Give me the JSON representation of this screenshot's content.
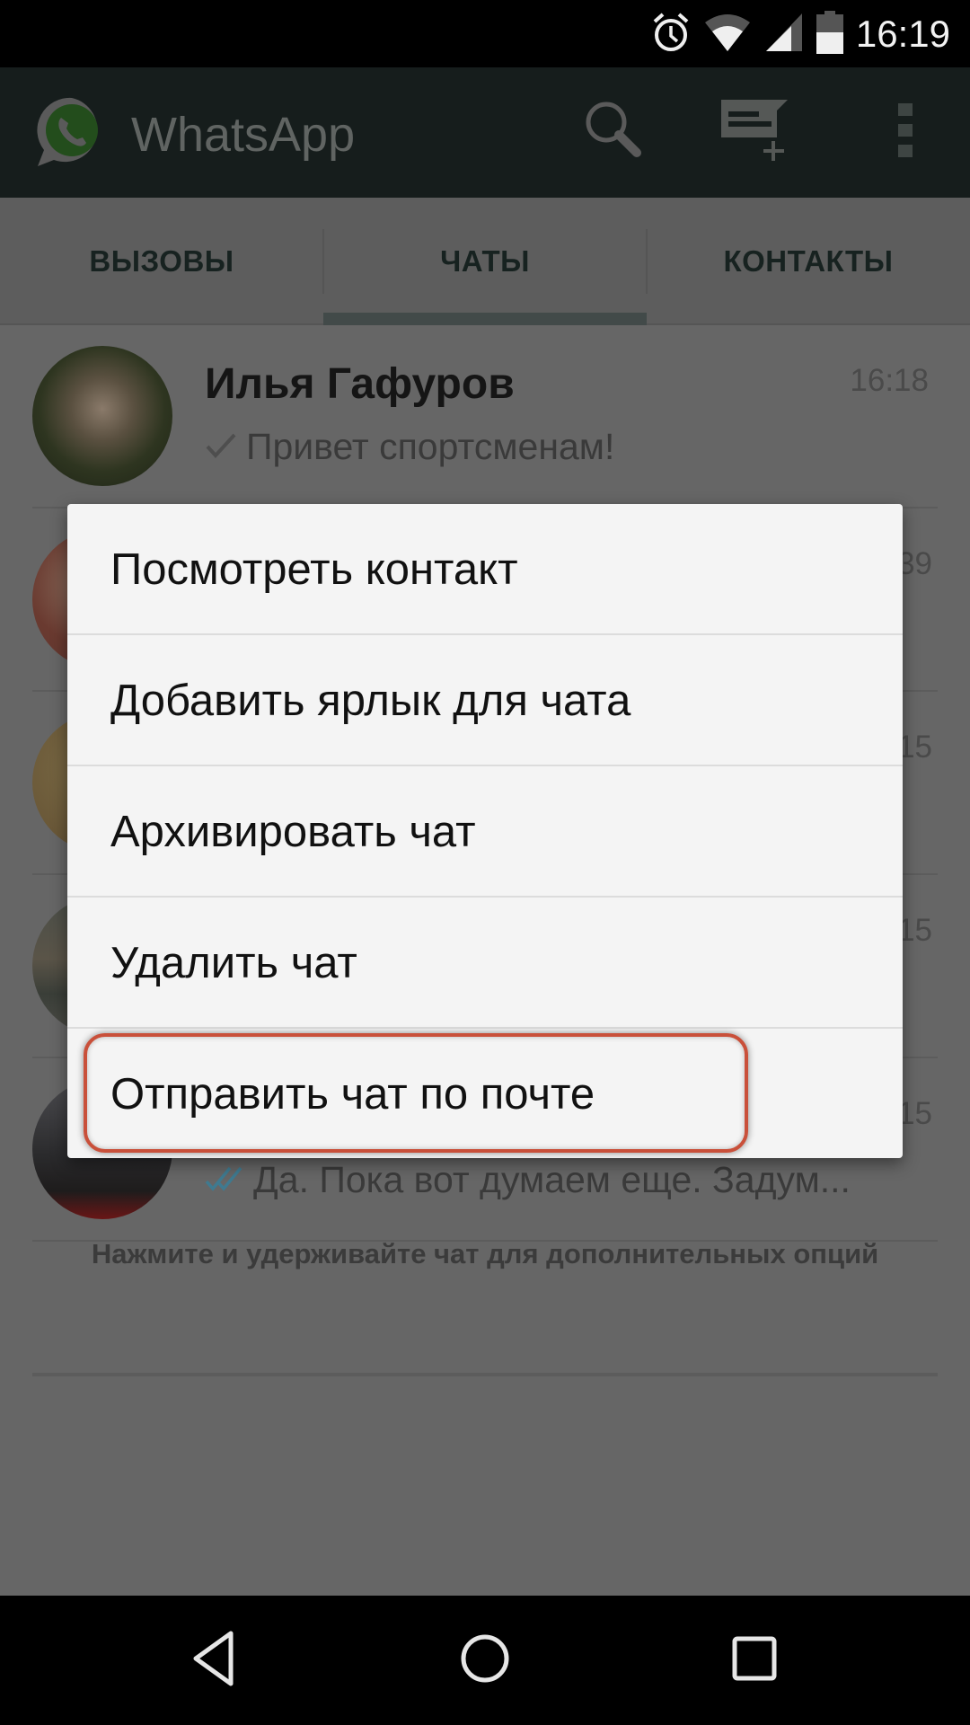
{
  "status_bar": {
    "time": "16:19",
    "icons": [
      "alarm-icon",
      "wifi-icon",
      "cell-signal-icon",
      "battery-icon"
    ]
  },
  "app_bar": {
    "title": "WhatsApp",
    "actions": [
      "search-icon",
      "new-chat-icon",
      "overflow-menu-icon"
    ]
  },
  "tabs": {
    "items": [
      {
        "label": "ВЫЗОВЫ",
        "selected": false
      },
      {
        "label": "ЧАТЫ",
        "selected": true
      },
      {
        "label": "КОНТАКТЫ",
        "selected": false
      }
    ]
  },
  "chats": [
    {
      "name": "Илья Гафуров",
      "time": "16:18",
      "message": "Привет спортсменам!",
      "status": "sent-single-check"
    },
    {
      "name": "",
      "time": "…39",
      "message": "",
      "status": ""
    },
    {
      "name": "",
      "time": "…15",
      "message": "",
      "status": ""
    },
    {
      "name": "",
      "time": "…15",
      "message": "",
      "status": ""
    },
    {
      "name": "",
      "time": "…15",
      "message": "Да. Пока вот думаем еще. Задум...",
      "status": "read-double-check"
    }
  ],
  "hint": "Нажмите и удерживайте чат для дополнительных опций",
  "context_menu": {
    "items": [
      {
        "label": "Посмотреть контакт"
      },
      {
        "label": "Добавить ярлык для чата"
      },
      {
        "label": "Архивировать чат"
      },
      {
        "label": "Удалить чат"
      },
      {
        "label": "Отправить чат по почте",
        "highlighted": true
      }
    ],
    "highlight_color": "#c9503a"
  },
  "nav_bar": {
    "buttons": [
      "back-icon",
      "home-icon",
      "recents-icon"
    ]
  },
  "colors": {
    "overlay_bg": "#666666",
    "dialog_bg": "#f4f4f4",
    "app_bar_dimmed": "#161d1c",
    "read_check": "#4a8fa8"
  }
}
